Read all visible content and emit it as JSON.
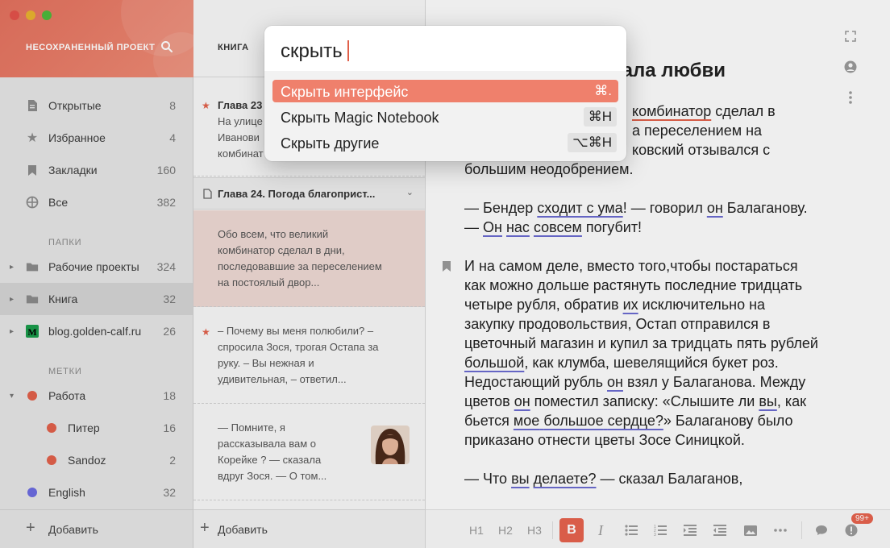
{
  "sidebar": {
    "project_title": "НЕСОХРАНЕННЫЙ ПРОЕКТ",
    "nav": [
      {
        "label": "Открытые",
        "count": "8"
      },
      {
        "label": "Избранное",
        "count": "4"
      },
      {
        "label": "Закладки",
        "count": "160"
      },
      {
        "label": "Все",
        "count": "382"
      }
    ],
    "folders_header": "ПАПКИ",
    "folders": [
      {
        "label": "Рабочие проекты",
        "count": "324"
      },
      {
        "label": "Книга",
        "count": "32"
      },
      {
        "label": "blog.golden-calf.ru",
        "count": "26"
      }
    ],
    "tags_header": "МЕТКИ",
    "tags": [
      {
        "label": "Работа",
        "count": "18",
        "color": "#e0604a"
      },
      {
        "label": "Питер",
        "count": "16",
        "color": "#e0604a"
      },
      {
        "label": "Sandoz",
        "count": "2",
        "color": "#e0604a"
      },
      {
        "label": "English",
        "count": "32",
        "color": "#6b6bdf"
      }
    ],
    "add_label": "Добавить"
  },
  "notelist": {
    "title": "КНИГА",
    "notes": [
      {
        "title": "Глава 23",
        "lines": [
          "На улице",
          "Иванови",
          "комбинат"
        ]
      },
      {
        "chapter": "Глава 24. Погода благоприст..."
      },
      {
        "lines": [
          "Обо всем, что великий",
          "комбинатор сделал в дни,",
          "последовавшие за переселением",
          "на постоялый двор..."
        ]
      },
      {
        "lines": [
          "– Почему вы меня полюбили? –",
          "спросила Зося, трогая Остапа за",
          "руку. – Вы нежная и",
          "удивительная, – ответил..."
        ]
      },
      {
        "lines": [
          "— Помните, я",
          "рассказывала вам о",
          "Корейке ? — сказала",
          "вдруг Зося. — О том..."
        ]
      }
    ],
    "add_label": "Добавить"
  },
  "editor": {
    "title_1": "а",
    "title_2": "зала любви",
    "p1_a": "комбинатор",
    "p1_b": " сделал в",
    "p1_c": "а переселением на",
    "p1_d": "ковский отзывался с",
    "p1_e": "большим неодобрением.",
    "p2": [
      "— Бендер ",
      "сходит с ума",
      "! — говорил ",
      "он",
      " Балаганову. — ",
      "Он",
      " ",
      "нас",
      " ",
      "совсем",
      " погубит!"
    ],
    "p3": [
      "И на самом деле, вместо того,чтобы постараться как можно дольше растянуть последние тридцать четыре рубля, обратив ",
      "их",
      " исключительно на закупку продовольствия, Остап отправился в цветочный магазин и купил за тридцать пять рублей ",
      "большой",
      ", как клумба, шевелящийся букет роз. Недостающий рубль ",
      "он",
      " взял у Балаганова. Между цветов ",
      "он",
      " поместил записку: «Слышите ли ",
      "вы",
      ", как бьется ",
      "мое",
      " ",
      "большое",
      " ",
      "сердце?",
      "» Балаганову было приказано отнести цветы Зосе Синицкой."
    ],
    "p4": [
      "— Что ",
      "вы",
      " ",
      "делаете?",
      " — сказал Балаганов,"
    ],
    "toolbar": [
      "H1",
      "H2",
      "H3",
      "B",
      "I"
    ],
    "badge": "99+"
  },
  "palette": {
    "query": "скрыть",
    "items": [
      {
        "label": "Скрыть интерфейс",
        "shortcut": "⌘."
      },
      {
        "label": "Скрыть Magic Notebook",
        "shortcut": "⌘H"
      },
      {
        "label": "Скрыть другие",
        "shortcut": "⌥⌘H"
      }
    ]
  }
}
